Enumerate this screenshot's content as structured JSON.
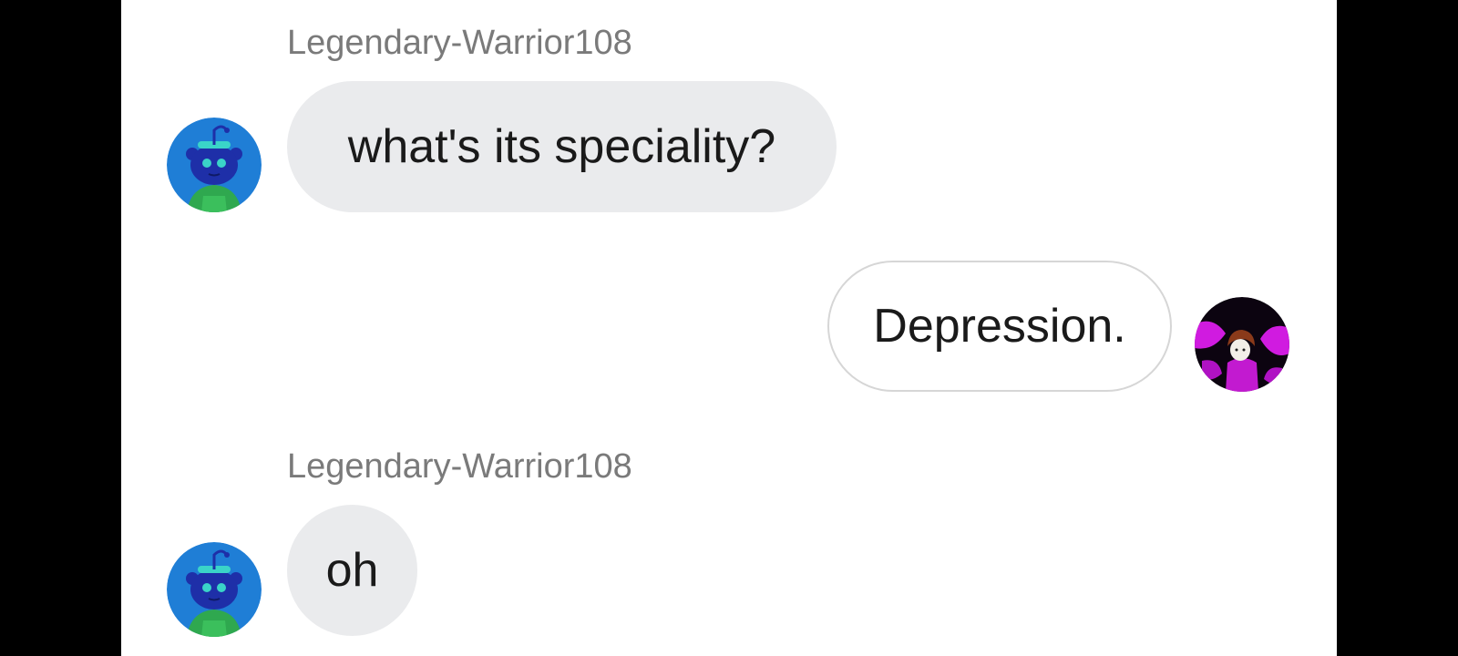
{
  "messages": [
    {
      "sender": "Legendary-Warrior108",
      "text": "what's its speciality?",
      "direction": "incoming",
      "avatar": "snoo-blue-avatar-icon"
    },
    {
      "text": "Depression.",
      "direction": "outgoing",
      "avatar": "magenta-character-avatar-icon"
    },
    {
      "sender": "Legendary-Warrior108",
      "text": "oh",
      "direction": "incoming",
      "avatar": "snoo-blue-avatar-icon"
    }
  ],
  "colors": {
    "incoming_bubble": "#eaebed",
    "outgoing_border": "#d6d6d6",
    "username": "#7a7a7a",
    "background": "#ffffff"
  }
}
